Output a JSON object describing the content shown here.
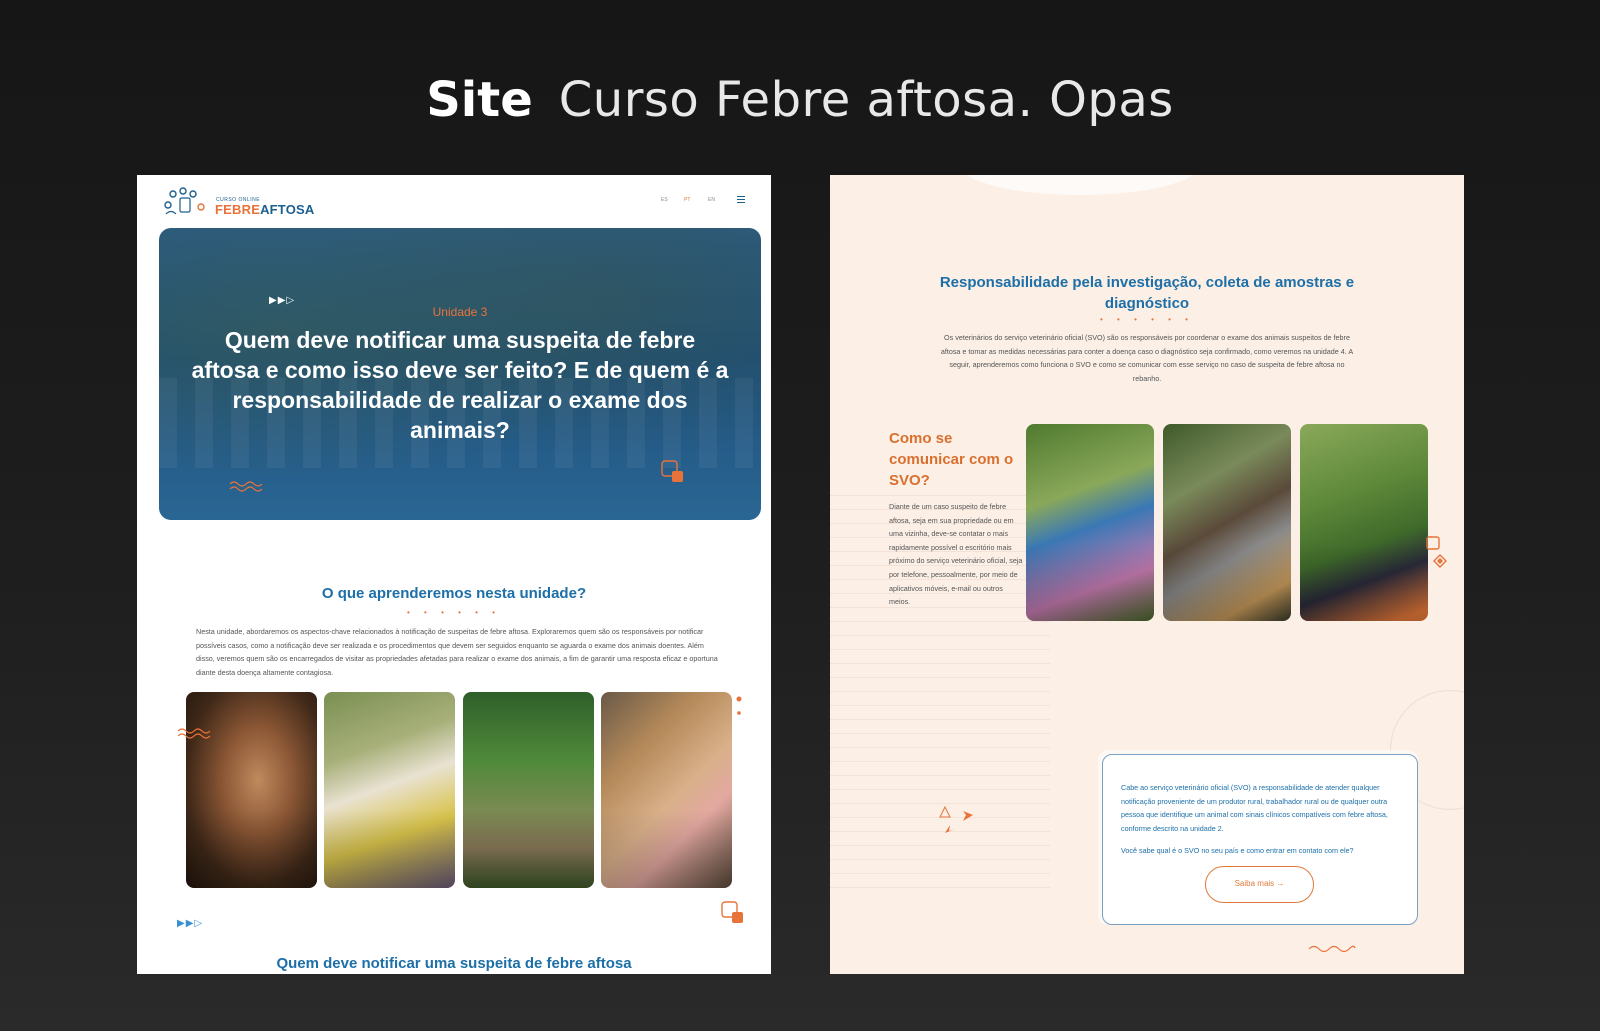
{
  "header": {
    "bold": "Site",
    "light": "Curso Febre aftosa. Opas"
  },
  "left": {
    "logo": {
      "small": "CURSO ONLINE",
      "text_a": "FEBRE",
      "text_b": "AFTOSA"
    },
    "languages": [
      "ES",
      "PT",
      "EN"
    ],
    "active_language": "PT",
    "hero": {
      "play_glyph": "▶▶▷",
      "unit": "Unidade 3",
      "title": "Quem deve notificar uma suspeita de febre aftosa e como isso deve ser feito? E de quem é a responsabilidade de realizar o exame dos animais?"
    },
    "section": {
      "title": "O que aprenderemos nesta unidade?",
      "dots": "• • • • • •",
      "text": "Nesta unidade, abordaremos os aspectos-chave relacionados à notificação de suspeitas de febre aftosa. Exploraremos quem são os responsáveis por notificar possíveis casos, como a notificação deve ser realizada e os procedimentos que devem ser seguidos enquanto se aguarda o exame dos animais doentes. Além disso, veremos quem são os encarregados de visitar as propriedades afetadas para realizar o exame dos animais, a fim de garantir uma resposta eficaz e oportuna diante desta doença altamente contagiosa."
    },
    "play_glyph_2": "▶▶▷",
    "section2_title": "Quem deve notificar uma suspeita de febre aftosa"
  },
  "right": {
    "title": "Responsabilidade pela investigação, coleta de amostras e diagnóstico",
    "dots": "• • • • • •",
    "text": "Os veterinários do serviço veterinário oficial (SVO) são os responsáveis por coordenar o exame dos animais suspeitos de febre aftosa e tomar as medidas necessárias para conter a doença caso o diagnóstico seja confirmado, como veremos na unidade 4. A seguir, aprenderemos como funciona o SVO e como se comunicar com esse serviço no caso de suspeita de febre aftosa no rebanho.",
    "subtitle": "Como se comunicar com o SVO?",
    "subtext": "Diante de um caso suspeito de febre aftosa, seja em sua propriedade ou em uma vizinha, deve-se contatar o mais rapidamente possível o escritório mais próximo do serviço veterinário oficial, seja por telefone, pessoalmente, por meio de aplicativos móveis, e-mail ou outros meios.",
    "box": {
      "text": "Cabe ao serviço veterinário oficial (SVO) a responsabilidade de atender qualquer notificação proveniente de um produtor rural, trabalhador rural ou de qualquer outra pessoa que identifique um animal com sinais clínicos compatíveis com febre aftosa, conforme descrito na unidade 2.",
      "question": "Você sabe qual é o SVO no seu país e como entrar em contato com ele?",
      "button": "Saiba mais →"
    }
  },
  "colors": {
    "blue": "#1d6fa8",
    "orange": "#e8733a",
    "cream": "#fbefe6"
  }
}
